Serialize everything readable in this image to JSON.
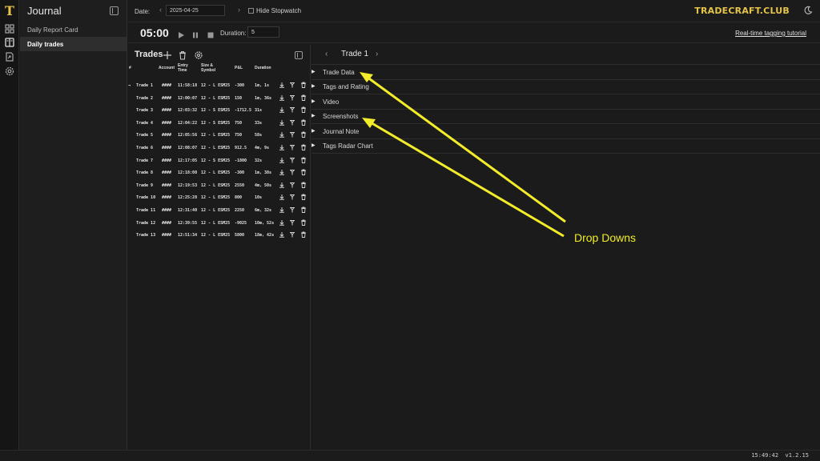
{
  "brand": {
    "name": "TRADECRAFT.CLUB",
    "color": "#e6c34a"
  },
  "journal": {
    "title": "Journal",
    "items": [
      {
        "label": "Daily Report Card",
        "active": false
      },
      {
        "label": "Daily trades",
        "active": true
      }
    ]
  },
  "topbar": {
    "date_label": "Date:",
    "date_value": "2025-04-25",
    "hide_stopwatch_label": "Hide Stopwatch"
  },
  "stopwatch": {
    "time": "05:00",
    "duration_label": "Duration:",
    "duration_value": "5",
    "tutorial_link": "Real-time tagging tutorial"
  },
  "trades": {
    "title": "Trades",
    "columns": {
      "num": "#",
      "account": "Account",
      "entry_time": "Entry Time",
      "size_symbol": "Size & Symbol",
      "pnl": "P&L",
      "duration": "Duration"
    },
    "rows": [
      {
        "name": "Trade 1",
        "account": "####",
        "entry": "11:58:18",
        "size": "12 - L ESM25",
        "pnl": "-300",
        "duration": "1m, 1s",
        "current": true
      },
      {
        "name": "Trade 2",
        "account": "####",
        "entry": "12:00:07",
        "size": "12 - L ESM25",
        "pnl": "150",
        "duration": "1m, 36s",
        "current": false
      },
      {
        "name": "Trade 3",
        "account": "####",
        "entry": "12:03:32",
        "size": "12 - S ESM25",
        "pnl": "-1712.5",
        "duration": "31s",
        "current": false
      },
      {
        "name": "Trade 4",
        "account": "####",
        "entry": "12:04:22",
        "size": "12 - S ESM25",
        "pnl": "750",
        "duration": "33s",
        "current": false
      },
      {
        "name": "Trade 5",
        "account": "####",
        "entry": "12:05:56",
        "size": "12 - L ESM25",
        "pnl": "750",
        "duration": "58s",
        "current": false
      },
      {
        "name": "Trade 6",
        "account": "####",
        "entry": "12:08:07",
        "size": "12 - L ESM25",
        "pnl": "912.5",
        "duration": "4m, 9s",
        "current": false
      },
      {
        "name": "Trade 7",
        "account": "####",
        "entry": "12:17:05",
        "size": "12 - S ESM25",
        "pnl": "-1800",
        "duration": "32s",
        "current": false
      },
      {
        "name": "Trade 8",
        "account": "####",
        "entry": "12:18:08",
        "size": "12 - L ESM25",
        "pnl": "-300",
        "duration": "1m, 38s",
        "current": false
      },
      {
        "name": "Trade 9",
        "account": "####",
        "entry": "12:19:53",
        "size": "12 - L ESM25",
        "pnl": "2550",
        "duration": "4m, 50s",
        "current": false
      },
      {
        "name": "Trade 10",
        "account": "####",
        "entry": "12:25:28",
        "size": "12 - L ESM25",
        "pnl": "800",
        "duration": "10s",
        "current": false
      },
      {
        "name": "Trade 11",
        "account": "####",
        "entry": "12:31:40",
        "size": "12 - L ESM25",
        "pnl": "2250",
        "duration": "6m, 32s",
        "current": false
      },
      {
        "name": "Trade 12",
        "account": "####",
        "entry": "12:39:55",
        "size": "12 - L ESM25",
        "pnl": "-9025",
        "duration": "10m, 52s",
        "current": false
      },
      {
        "name": "Trade 13",
        "account": "####",
        "entry": "12:51:34",
        "size": "12 - L ESM25",
        "pnl": "5800",
        "duration": "18m, 42s",
        "current": false
      }
    ]
  },
  "detail": {
    "title": "Trade 1",
    "sections": [
      {
        "label": "Trade Data"
      },
      {
        "label": "Tags and Rating"
      },
      {
        "label": "Video"
      },
      {
        "label": "Screenshots"
      },
      {
        "label": "Journal Note"
      },
      {
        "label": "Tags Radar Chart"
      }
    ]
  },
  "annotation": {
    "label": "Drop Downs",
    "color": "#f2ec2a"
  },
  "status": {
    "clock": "15:49:42",
    "version": "v1.2.15"
  }
}
